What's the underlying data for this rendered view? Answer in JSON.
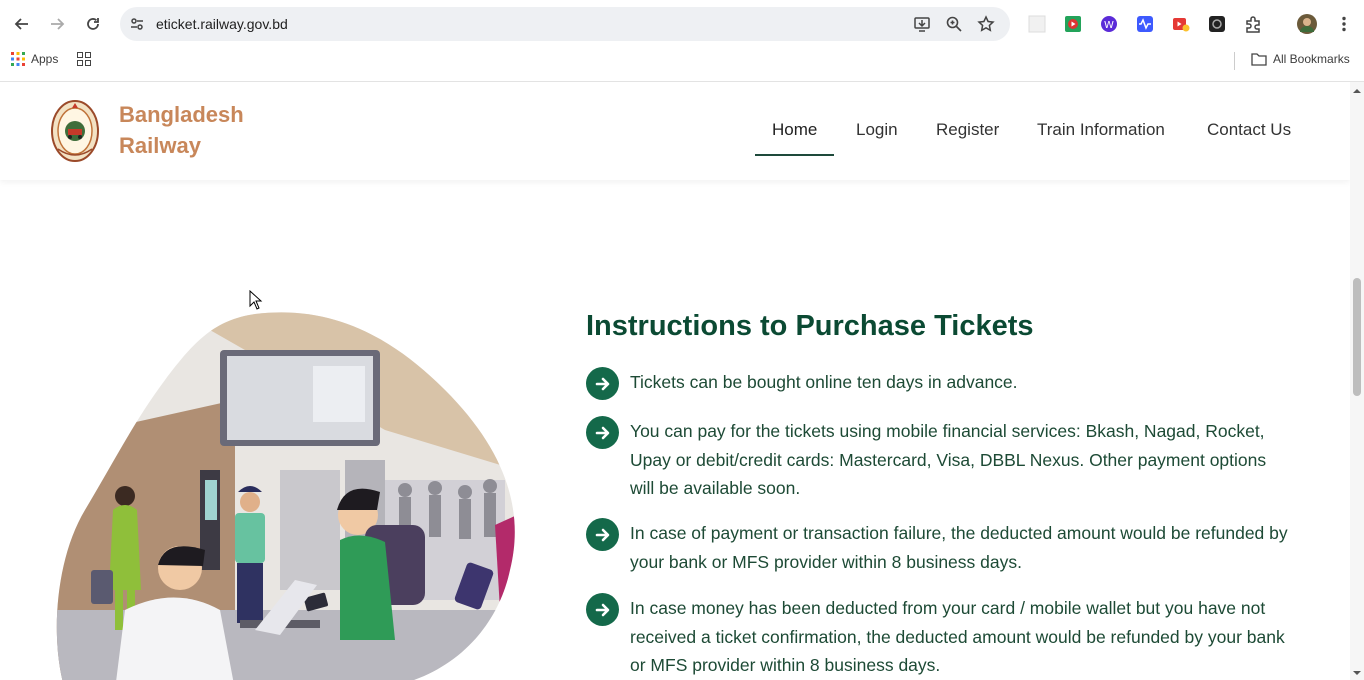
{
  "browser": {
    "url": "eticket.railway.gov.bd",
    "bookmarks": {
      "apps_label": "Apps",
      "all_bookmarks_label": "All Bookmarks"
    }
  },
  "site": {
    "brand_line1": "Bangladesh",
    "brand_line2": "Railway",
    "nav": [
      {
        "label": "Home",
        "active": true
      },
      {
        "label": "Login"
      },
      {
        "label": "Register"
      },
      {
        "label": "Train Information"
      },
      {
        "label": "Contact Us"
      }
    ]
  },
  "instructions": {
    "title": "Instructions to Purchase Tickets",
    "items": [
      "Tickets can be bought online ten days in advance.",
      "You can pay for the tickets using mobile financial services: Bkash, Nagad, Rocket, Upay or debit/credit cards: Mastercard, Visa, DBBL Nexus. Other payment options will be available soon.",
      "In case of payment or transaction failure, the deducted amount would be refunded by your bank or MFS provider within 8 business days.",
      "In case money has been deducted from your card / mobile wallet but you have not received a ticket confirmation, the deducted amount would be refunded by your bank or MFS provider within 8 business days."
    ]
  },
  "colors": {
    "brand": "#c8875a",
    "heading": "#0b4a33",
    "bullet": "#14694a",
    "nav_active": "#1e4a3b"
  }
}
